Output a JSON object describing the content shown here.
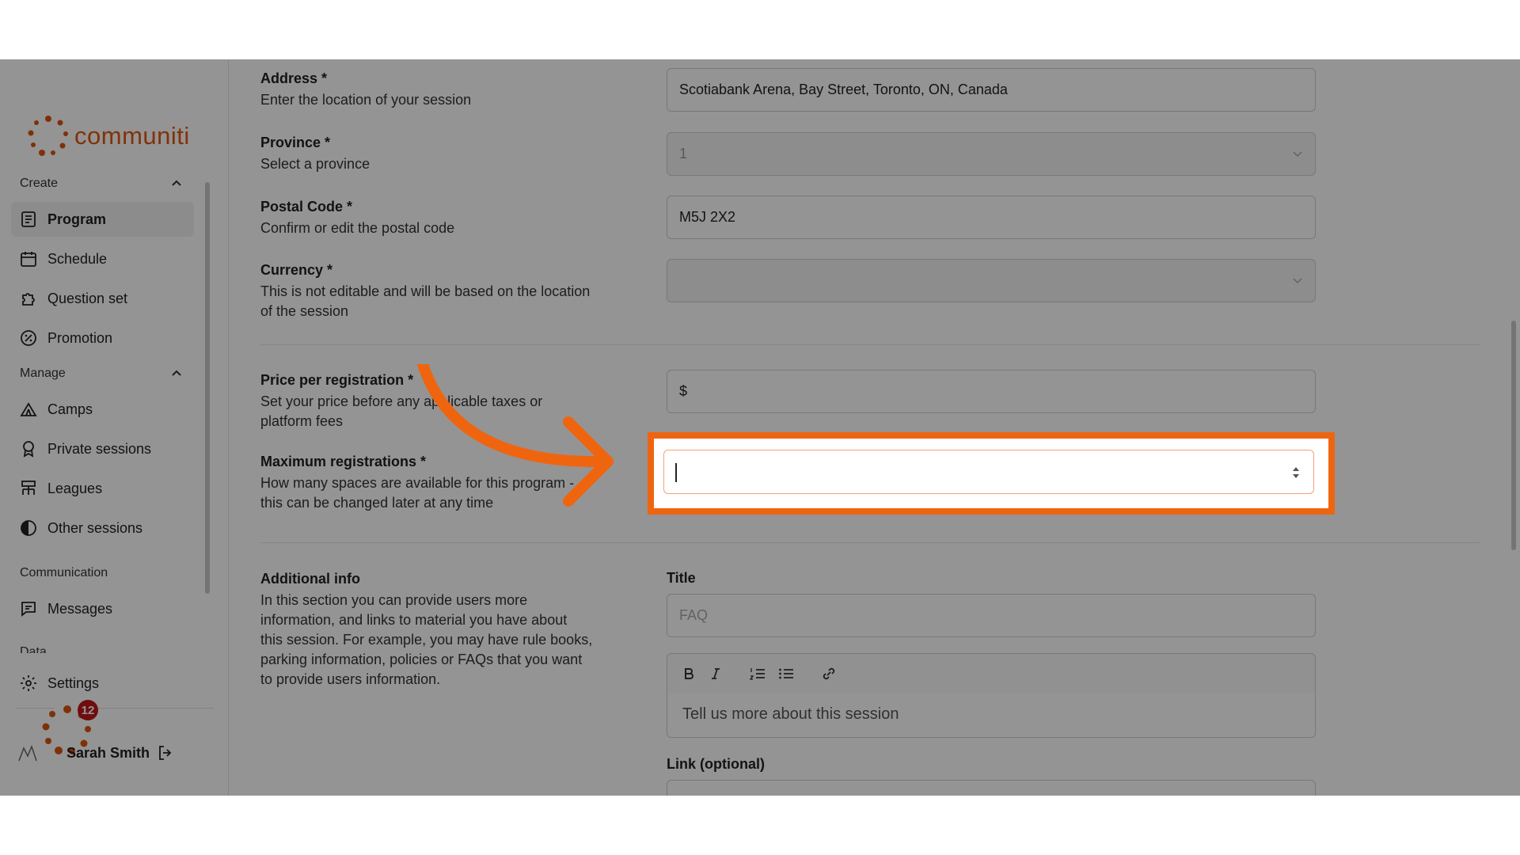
{
  "app": {
    "logo_text": "communiti"
  },
  "sidebar": {
    "create_label": "Create",
    "manage_label": "Manage",
    "communication_label": "Communication",
    "data_label": "Data",
    "items_create": [
      {
        "label": "Program",
        "icon": "program-icon",
        "active": true
      },
      {
        "label": "Schedule",
        "icon": "schedule-icon"
      },
      {
        "label": "Question set",
        "icon": "puzzle-icon"
      },
      {
        "label": "Promotion",
        "icon": "percent-icon"
      }
    ],
    "items_manage": [
      {
        "label": "Camps",
        "icon": "camp-icon"
      },
      {
        "label": "Private sessions",
        "icon": "ribbon-icon"
      },
      {
        "label": "Leagues",
        "icon": "league-icon"
      },
      {
        "label": "Other sessions",
        "icon": "half-circle-icon"
      }
    ],
    "items_comm": [
      {
        "label": "Messages",
        "icon": "message-icon"
      }
    ],
    "settings_label": "Settings",
    "user_name": "Sarah Smith",
    "notification_count": "12"
  },
  "form": {
    "address_label": "Address *",
    "address_desc": "Enter the location of your session",
    "address_value": "Scotiabank Arena, Bay Street, Toronto, ON, Canada",
    "province_label": "Province *",
    "province_desc": "Select a province",
    "province_value": "1",
    "postal_label": "Postal Code *",
    "postal_desc": "Confirm or edit the postal code",
    "postal_value": "M5J 2X2",
    "currency_label": "Currency *",
    "currency_desc": "This is not editable and will be based on the location of the session",
    "currency_value": "",
    "price_label": "Price per registration *",
    "price_desc": "Set your price before any applicable taxes or platform fees",
    "price_prefix": "$",
    "max_label": "Maximum registrations *",
    "max_desc": "How many spaces are available for this program - this can be changed later at any time",
    "max_value": "",
    "additional_label": "Additional info",
    "additional_desc": "In this section you can provide users more information, and links to material you have about this session. For example, you may have rule books, parking information, policies or FAQs that you want to provide users information.",
    "title_label": "Title",
    "title_placeholder": "FAQ",
    "rte_placeholder": "Tell us more about this session",
    "link_label": "Link (optional)"
  },
  "colors": {
    "accent": "#ef650f",
    "badge": "#c0171b"
  }
}
